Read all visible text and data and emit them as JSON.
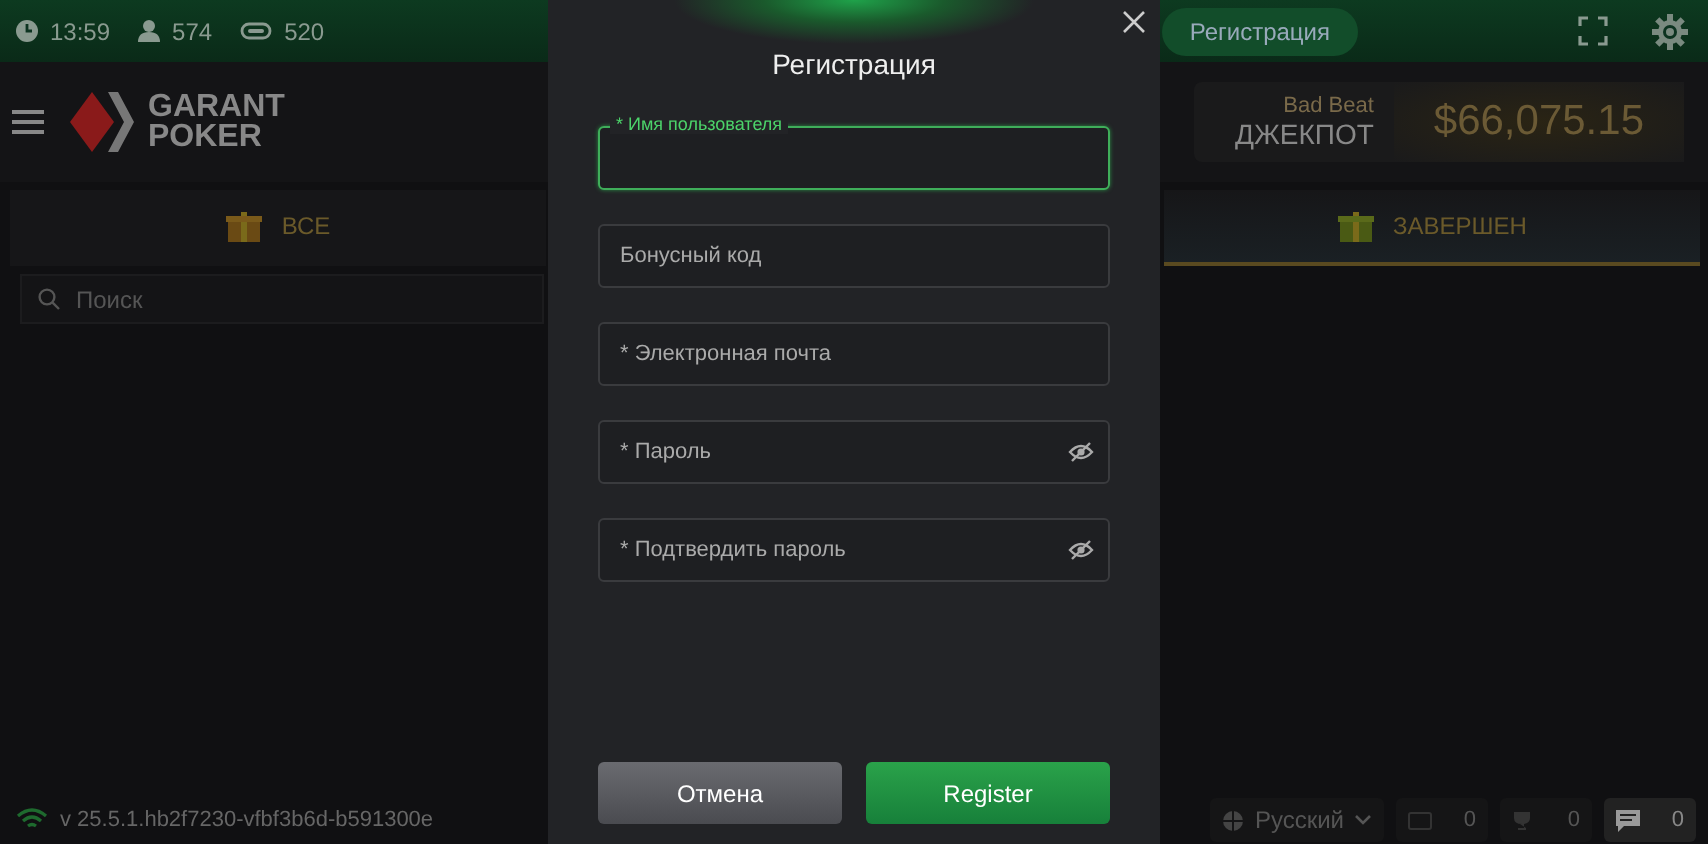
{
  "status_bar": {
    "time": "13:59",
    "players": "574",
    "tables": "520",
    "register_button": "Регистрация"
  },
  "header": {
    "logo": [
      "GARANT",
      "POKER"
    ],
    "jackpot": {
      "caption": "Bad Beat",
      "title": "ДЖЕКПОТ",
      "amount": "$66,075.15"
    }
  },
  "tabs": [
    {
      "label": "ВСЕ",
      "selected": false
    },
    {
      "label": "ЗАВЕРШЕН",
      "selected": true
    }
  ],
  "search": {
    "placeholder": "Поиск"
  },
  "footer": {
    "version": "v 25.5.1.hb2f7230-vfbf3b6d-b591300e",
    "language": "Русский",
    "counters": [
      {
        "kind": "cards",
        "value": "0"
      },
      {
        "kind": "trophy",
        "value": "0"
      },
      {
        "kind": "chat",
        "value": "0"
      }
    ]
  },
  "dialog": {
    "title": "Регистрация",
    "fields": [
      {
        "placeholder": "* Имя пользователя",
        "focused": true,
        "kind": "text"
      },
      {
        "placeholder": "Бонусный код",
        "focused": false,
        "kind": "text"
      },
      {
        "placeholder": "* Электронная почта",
        "focused": false,
        "kind": "text"
      },
      {
        "placeholder": "* Пароль",
        "focused": false,
        "kind": "password"
      },
      {
        "placeholder": "* Подтвердить пароль",
        "focused": false,
        "kind": "password"
      }
    ],
    "buttons": [
      {
        "label": "Отмена",
        "kind": "secondary"
      },
      {
        "label": "Register",
        "kind": "primary"
      }
    ]
  }
}
